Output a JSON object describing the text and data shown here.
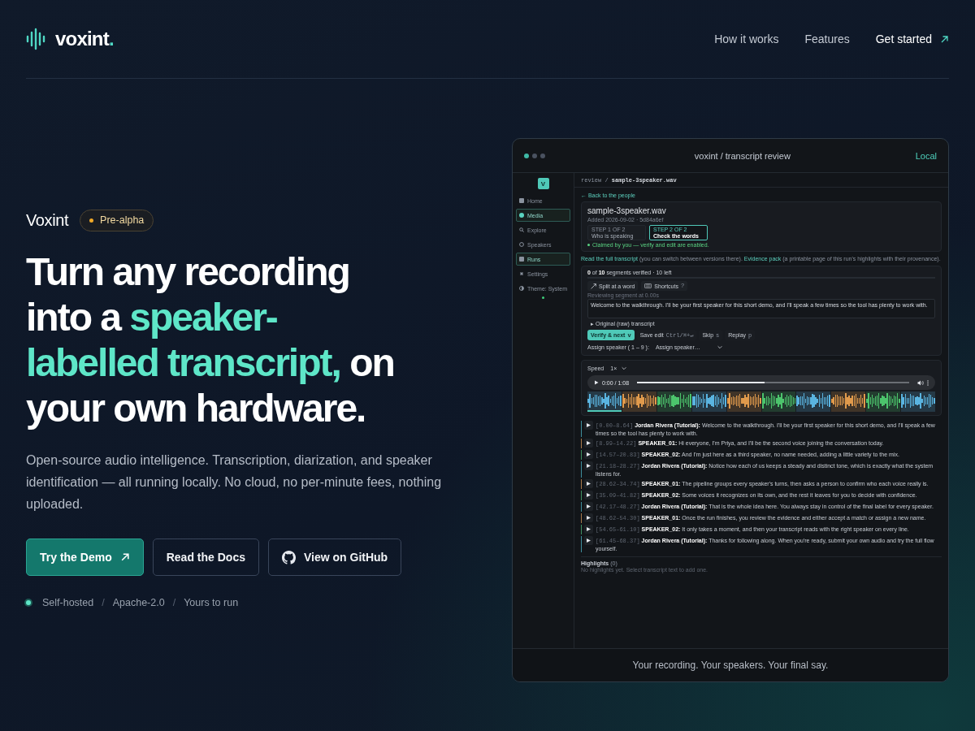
{
  "nav": {
    "logo": {
      "name": "voxint",
      "mark": "."
    },
    "links": [
      {
        "label": "How it works",
        "kind": "link"
      },
      {
        "label": "Features",
        "kind": "link"
      },
      {
        "label": "Get started",
        "kind": "cta"
      }
    ]
  },
  "hero": {
    "product": "Voxint",
    "badge": "Pre-alpha",
    "headline": [
      {
        "text": "Turn any recording into a ",
        "highlight": false
      },
      {
        "text": "speaker-labelled transcript,",
        "highlight": true
      },
      {
        "text": " on your own hardware.",
        "highlight": false
      }
    ],
    "description": "Open-source audio intelligence. Transcription, diarization, and speaker identification — all running locally. No cloud, no per-minute fees, nothing uploaded.",
    "buttons": [
      {
        "label": "Try the Demo",
        "kind": "primary"
      },
      {
        "label": "Read the Docs",
        "kind": "secondary"
      },
      {
        "label": "View on GitHub",
        "kind": "github"
      }
    ],
    "facts": [
      {
        "text": "Self-hosted",
        "kind": "fact"
      },
      {
        "text": "/",
        "kind": "sep"
      },
      {
        "text": "Apache-2.0",
        "kind": "fact"
      },
      {
        "text": "/",
        "kind": "sep"
      },
      {
        "text": "Yours to run",
        "kind": "fact"
      }
    ]
  },
  "preview": {
    "title": "voxint / transcript review",
    "mode": "Local",
    "sidebar": {
      "logo": "V",
      "items": [
        {
          "label": "Home",
          "selected": false
        },
        {
          "label": "Media",
          "selected": true
        },
        {
          "label": "Explore",
          "selected": false
        },
        {
          "label": "Speakers",
          "selected": false
        },
        {
          "label": "Runs",
          "selected": true
        },
        {
          "label": "Settings",
          "selected": false
        },
        {
          "label": "Theme: System",
          "selected": false
        }
      ]
    },
    "breadcrumb": "review / **sample-3speaker.wav**",
    "back_link": "← Back to the people",
    "file": {
      "name": "sample-3speaker.wav",
      "meta": "Added 2026-09-02 · 5d84a6ef",
      "steps": [
        {
          "step": "STEP 1 OF 2",
          "label": "Who is speaking",
          "selected": false
        },
        {
          "step": "STEP 2 OF 2",
          "label": "Check the words",
          "selected": true
        }
      ],
      "claim": "Claimed by you — verify and edit are enabled."
    },
    "links_line": [
      {
        "text": "Read the full transcript",
        "kind": "link"
      },
      {
        "text": " (you can switch between versions there). ",
        "kind": "text"
      },
      {
        "text": "Evidence pack",
        "kind": "link"
      },
      {
        "text": " (a printable page of this run's highlights with their provenance).",
        "kind": "text"
      }
    ],
    "review": {
      "progress_text": "**0** of **10** segments verified · 10 left",
      "level": 0,
      "tools": [
        {
          "label": "Split at a word"
        },
        {
          "label": "Shortcuts",
          "key": "?"
        }
      ],
      "segment_label": "Reviewing segment at 0.00s",
      "segment_text": "Welcome to the walkthrough. I'll be your first speaker for this short demo, and I'll speak a few times so the tool has plenty to work with.",
      "raw_toggle": "▸ Original (raw) transcript",
      "actions": [
        {
          "label": "Verify & next",
          "key": "v",
          "kind": "primary"
        },
        {
          "label": "Save edit",
          "key": "Ctrl/⌘+↵",
          "kind": "plain"
        },
        {
          "label": "Skip",
          "key": "s",
          "kind": "plain"
        },
        {
          "label": "Replay",
          "key": "p",
          "kind": "plain"
        }
      ],
      "assign_label": "Assign speaker ( 1 – 9 ):",
      "assign_select": "Assign speaker…"
    },
    "player": {
      "speed_label": "Speed",
      "speed": "1×",
      "time": "0:00 / 1:08",
      "level": 0.47,
      "waveform": [
        {
          "color": "#5ab4e0",
          "selected": true
        },
        {
          "color": "#e09a4c",
          "selected": false
        },
        {
          "color": "#4cc46c",
          "selected": false
        },
        {
          "color": "#5ab4e0",
          "selected": false
        },
        {
          "color": "#e09a4c",
          "selected": false
        },
        {
          "color": "#4cc46c",
          "selected": false
        },
        {
          "color": "#5ab4e0",
          "selected": false
        },
        {
          "color": "#e09a4c",
          "selected": false
        },
        {
          "color": "#4cc46c",
          "selected": false
        },
        {
          "color": "#5ab4e0",
          "selected": false
        }
      ]
    },
    "transcript": [
      {
        "time": "[0.00–8.64]",
        "speaker": "Jordan Rivera (Tutorial):",
        "text": "Welcome to the walkthrough. I'll be your first speaker for this short demo, and I'll speak a few times so the tool has plenty to work with.",
        "color": "#3f8e9c"
      },
      {
        "time": "[8.99–14.22]",
        "speaker": "SPEAKER_01:",
        "text": "Hi everyone, I'm Priya, and I'll be the second voice joining the conversation today.",
        "color": "#a8794a"
      },
      {
        "time": "[14.57–20.83]",
        "speaker": "SPEAKER_02:",
        "text": "And I'm just here as a third speaker, no name needed, adding a little variety to the mix.",
        "color": "#3f8f62"
      },
      {
        "time": "[21.18–28.27]",
        "speaker": "Jordan Rivera (Tutorial):",
        "text": "Notice how each of us keeps a steady and distinct tone, which is exactly what the system listens for.",
        "color": "#3f8e9c"
      },
      {
        "time": "[28.62–34.74]",
        "speaker": "SPEAKER_01:",
        "text": "The pipeline groups every speaker's turns, then asks a person to confirm who each voice really is.",
        "color": "#a8794a"
      },
      {
        "time": "[35.09–41.82]",
        "speaker": "SPEAKER_02:",
        "text": "Some voices it recognizes on its own, and the rest it leaves for you to decide with confidence.",
        "color": "#3f8f62"
      },
      {
        "time": "[42.17–48.27]",
        "speaker": "Jordan Rivera (Tutorial):",
        "text": "That is the whole idea here. You always stay in control of the final label for every speaker.",
        "color": "#3f8e9c"
      },
      {
        "time": "[48.62–54.30]",
        "speaker": "SPEAKER_01:",
        "text": "Once the run finishes, you review the evidence and either accept a match or assign a new name.",
        "color": "#a8794a"
      },
      {
        "time": "[54.65–61.10]",
        "speaker": "SPEAKER_02:",
        "text": "It only takes a moment, and then your transcript reads with the right speaker on every line.",
        "color": "#3f8f62"
      },
      {
        "time": "[61.45–68.37]",
        "speaker": "Jordan Rivera (Tutorial):",
        "text": "Thanks for following along. When you're ready, submit your own audio and try the full flow yourself.",
        "color": "#3f8e9c"
      }
    ],
    "highlights": {
      "title": "**Highlights** (0)",
      "empty": "No highlights yet. Select transcript text to add one."
    },
    "caption": "Your recording. Your speakers. Your final say."
  }
}
